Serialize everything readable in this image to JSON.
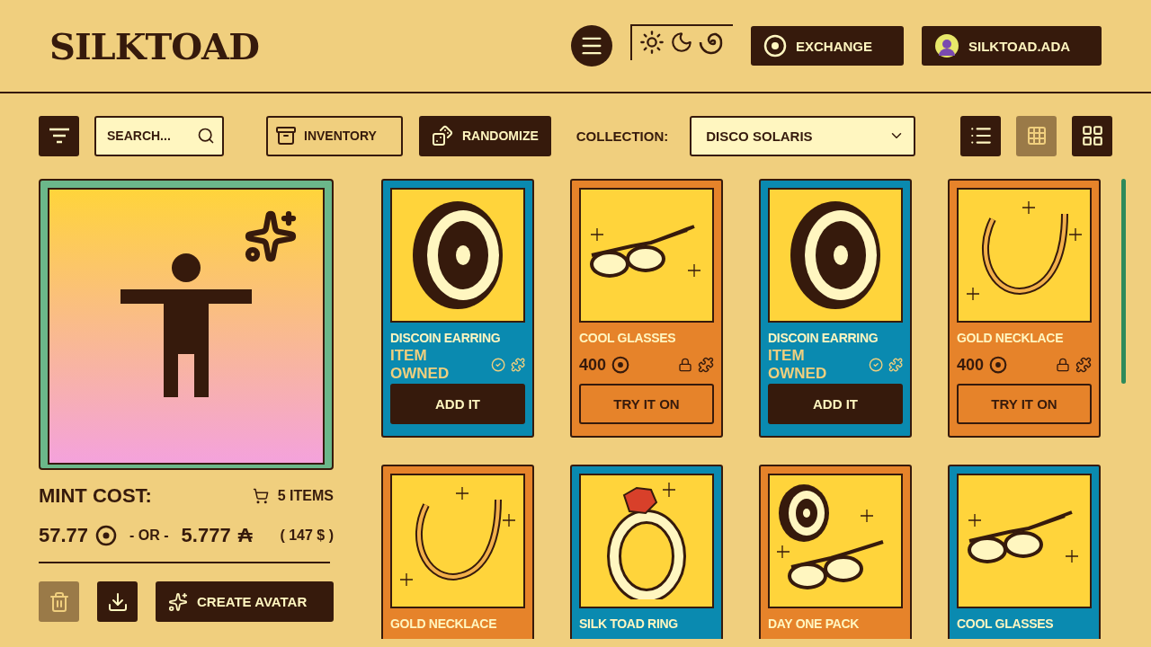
{
  "header": {
    "logo": "SILKTOAD",
    "exchange": "EXCHANGE",
    "account": "SILKTOAD.ADA"
  },
  "toolbar": {
    "search": {
      "placeholder": "SEARCH..."
    },
    "inventory": "INVENTORY",
    "randomize": "RANDOMIZE",
    "collection_label": "COLLECTION:",
    "collection_value": "DISCO SOLARIS",
    "views": [
      {
        "kind": "list",
        "selected": false
      },
      {
        "kind": "small-grid",
        "selected": true
      },
      {
        "kind": "large-grid",
        "selected": false
      }
    ]
  },
  "preview": {
    "mint_cost_label": "MINT COST:",
    "items_count": "5 ITEMS",
    "token_price": "57.77",
    "or": "- OR -",
    "ada_price": "5.777",
    "ada_symbol": "₳",
    "usd_price": "( 147 $ )",
    "delete_disabled": true,
    "create": "CREATE AVATAR"
  },
  "items": [
    {
      "kind": "owned",
      "name": "DISCOIN EARRING",
      "status": "ITEM OWNED",
      "action": "ADD IT"
    },
    {
      "kind": "locked",
      "name": "COOL GLASSES",
      "price": "400",
      "action": "TRY IT ON"
    },
    {
      "kind": "owned",
      "name": "DISCOIN EARRING",
      "status": "ITEM OWNED",
      "action": "ADD IT"
    },
    {
      "kind": "locked",
      "name": "GOLD NECKLACE",
      "price": "400",
      "action": "TRY IT ON"
    },
    {
      "kind": "locked",
      "name": "GOLD NECKLACE"
    },
    {
      "kind": "owned",
      "name": "SILK TOAD RING"
    },
    {
      "kind": "locked",
      "name": "DAY ONE PACK"
    },
    {
      "kind": "owned",
      "name": "COOL GLASSES"
    }
  ]
}
